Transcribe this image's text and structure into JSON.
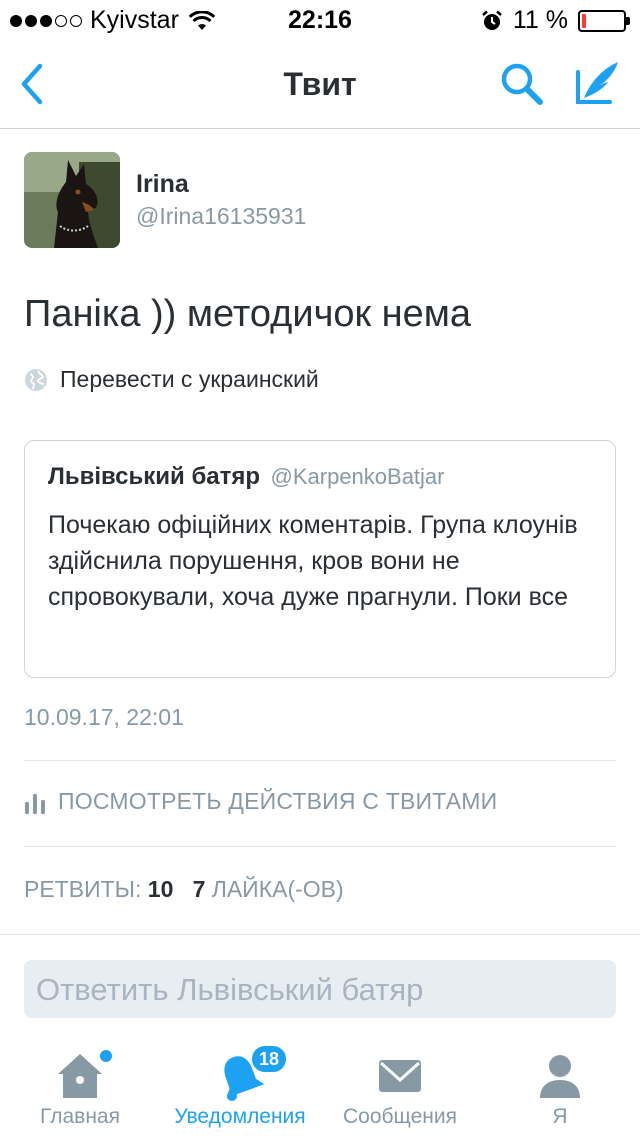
{
  "status_bar": {
    "carrier": "Kyivstar",
    "time": "22:16",
    "battery_percent": "11 %",
    "battery_level": 0.11,
    "battery_color": "#ff3b30"
  },
  "nav": {
    "title": "Твит",
    "back_icon": "chevron-left-icon",
    "search_icon": "search-icon",
    "compose_icon": "compose-tweet-icon",
    "accent": "#1da1f2"
  },
  "tweet": {
    "author_name": "Irina",
    "author_handle": "@Irina16135931",
    "text": "Паніка )) методичок нема",
    "translate_label": "Перевести с украинский",
    "timestamp": "10.09.17, 22:01",
    "activity_label": "ПОСМОТРЕТЬ ДЕЙСТВИЯ С ТВИТАМИ",
    "retweets_label": "РЕТВИТЫ:",
    "retweets_count": "10",
    "likes_count": "7",
    "likes_label": "ЛАЙКА(-ОВ)"
  },
  "quoted_tweet": {
    "name": "Львівський батяр",
    "handle": "@KarpenkoBatjar",
    "text": "Почекаю офіційних коментарів. Група клоунів здійснила порушення, кров вони не спровокували, хоча дуже прагнули. Поки все"
  },
  "reply": {
    "placeholder": "Ответить Львівський батяр"
  },
  "tab_bar": {
    "tabs": [
      {
        "label": "Главная",
        "icon": "home-icon"
      },
      {
        "label": "Уведомления",
        "icon": "bell-icon",
        "badge": "18"
      },
      {
        "label": "Сообщения",
        "icon": "envelope-icon"
      },
      {
        "label": "Я",
        "icon": "profile-icon"
      }
    ],
    "active_index": 1
  }
}
